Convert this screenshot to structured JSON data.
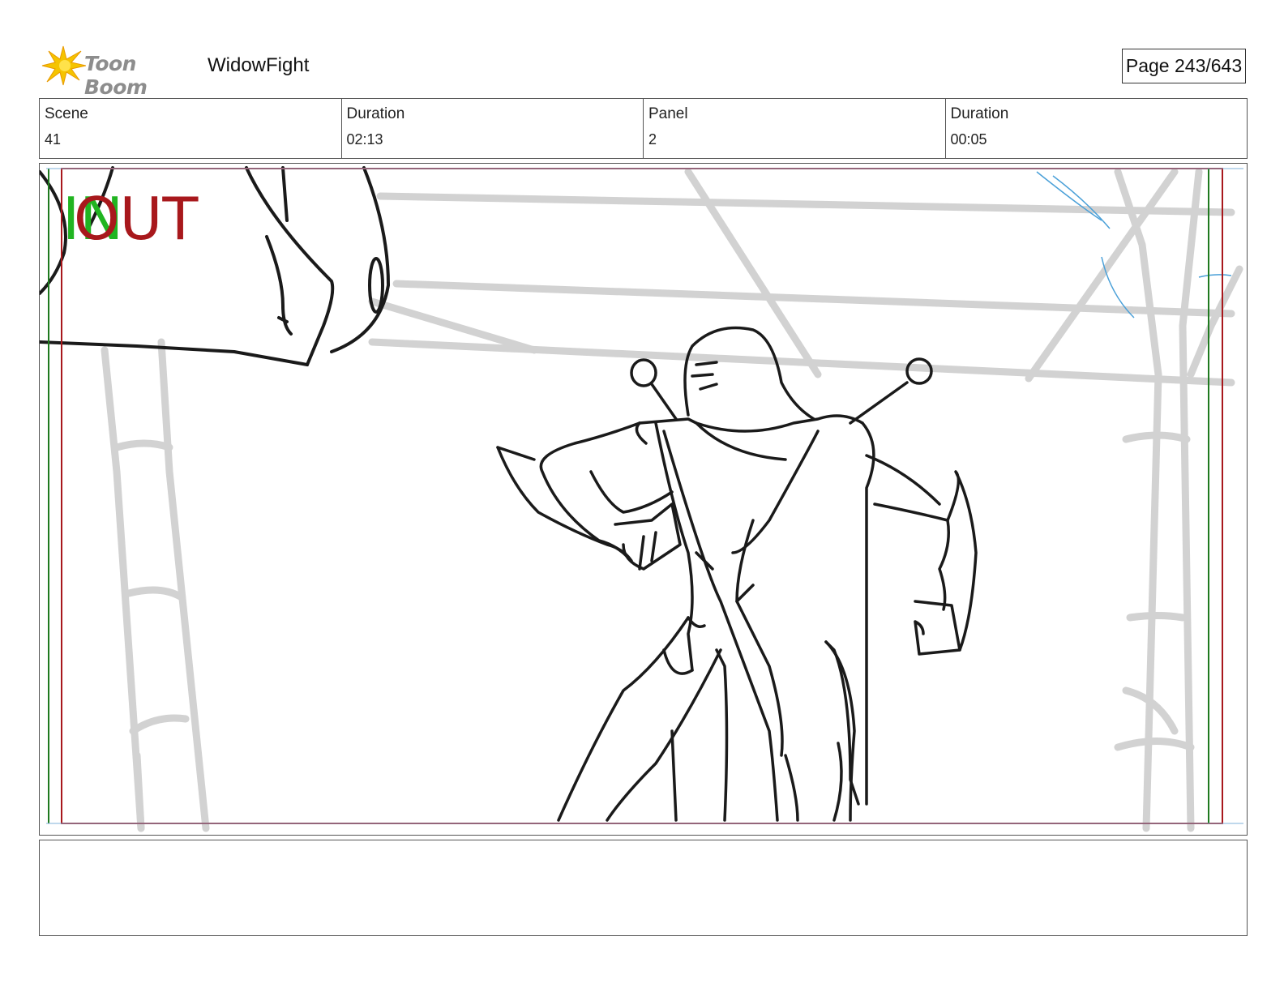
{
  "header": {
    "logo_text": "Toon Boom",
    "project_title": "WidowFight",
    "page_label": "Page 243/643"
  },
  "info": {
    "scene_label": "Scene",
    "scene_value": "41",
    "scene_duration_label": "Duration",
    "scene_duration_value": "02:13",
    "panel_label": "Panel",
    "panel_value": "2",
    "panel_duration_label": "Duration",
    "panel_duration_value": "00:05"
  },
  "panel_markers": {
    "in_text": "IN",
    "out_text": "OUT",
    "in_color": "#21b421",
    "out_color": "#a8181c"
  },
  "notes": {
    "text": ""
  }
}
